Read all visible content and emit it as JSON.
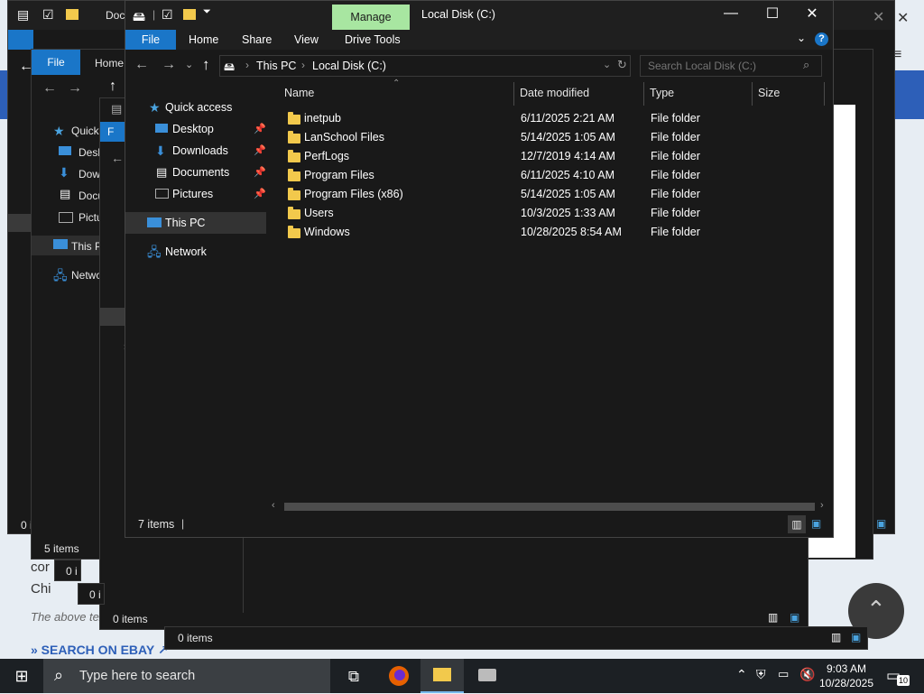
{
  "background_page": {
    "text_fragment_1": "cor",
    "text_fragment_2": "Chi",
    "italic_note": "The above tex",
    "link_text": "» SEARCH ON EBAY ↗"
  },
  "back_windows": {
    "w1_title": "Doc",
    "w2_tab_file": "File",
    "w2_tab_home": "Home",
    "w2_nav": [
      "Quick",
      "Desk",
      "Dow",
      "Docu",
      "Pictu",
      "This P",
      "Netwo"
    ],
    "w2_status": "5 items",
    "w1_status": "0 i",
    "w3_status": "0 items",
    "w4_status": "0 items",
    "w5_status": "0 i",
    "w6_status": "0 i",
    "w3_tab": "F"
  },
  "main_window": {
    "title": "Local Disk (C:)",
    "context_tab": "Manage",
    "ribbon_tabs": {
      "file": "File",
      "home": "Home",
      "share": "Share",
      "view": "View",
      "drive_tools": "Drive Tools"
    },
    "breadcrumb": [
      "This PC",
      "Local Disk (C:)"
    ],
    "search_placeholder": "Search Local Disk (C:)",
    "nav_pane": {
      "quick_access": "Quick access",
      "desktop": "Desktop",
      "downloads": "Downloads",
      "documents": "Documents",
      "pictures": "Pictures",
      "this_pc": "This PC",
      "network": "Network"
    },
    "columns": {
      "name": "Name",
      "date_modified": "Date modified",
      "type": "Type",
      "size": "Size"
    },
    "files": [
      {
        "name": "inetpub",
        "date": "6/11/2025 2:21 AM",
        "type": "File folder"
      },
      {
        "name": "LanSchool Files",
        "date": "5/14/2025 1:05 AM",
        "type": "File folder"
      },
      {
        "name": "PerfLogs",
        "date": "12/7/2019 4:14 AM",
        "type": "File folder"
      },
      {
        "name": "Program Files",
        "date": "6/11/2025 4:10 AM",
        "type": "File folder"
      },
      {
        "name": "Program Files (x86)",
        "date": "5/14/2025 1:05 AM",
        "type": "File folder"
      },
      {
        "name": "Users",
        "date": "10/3/2025 1:33 AM",
        "type": "File folder"
      },
      {
        "name": "Windows",
        "date": "10/28/2025 8:54 AM",
        "type": "File folder"
      }
    ],
    "status": "7 items"
  },
  "taskbar": {
    "search_placeholder": "Type here to search",
    "time": "9:03 AM",
    "date": "10/28/2025",
    "notification_count": "10"
  },
  "colors": {
    "accent_blue": "#1a76c8",
    "manage_tab": "#a8e6a1",
    "folder_yellow": "#f2c94c",
    "window_bg": "#191919"
  }
}
